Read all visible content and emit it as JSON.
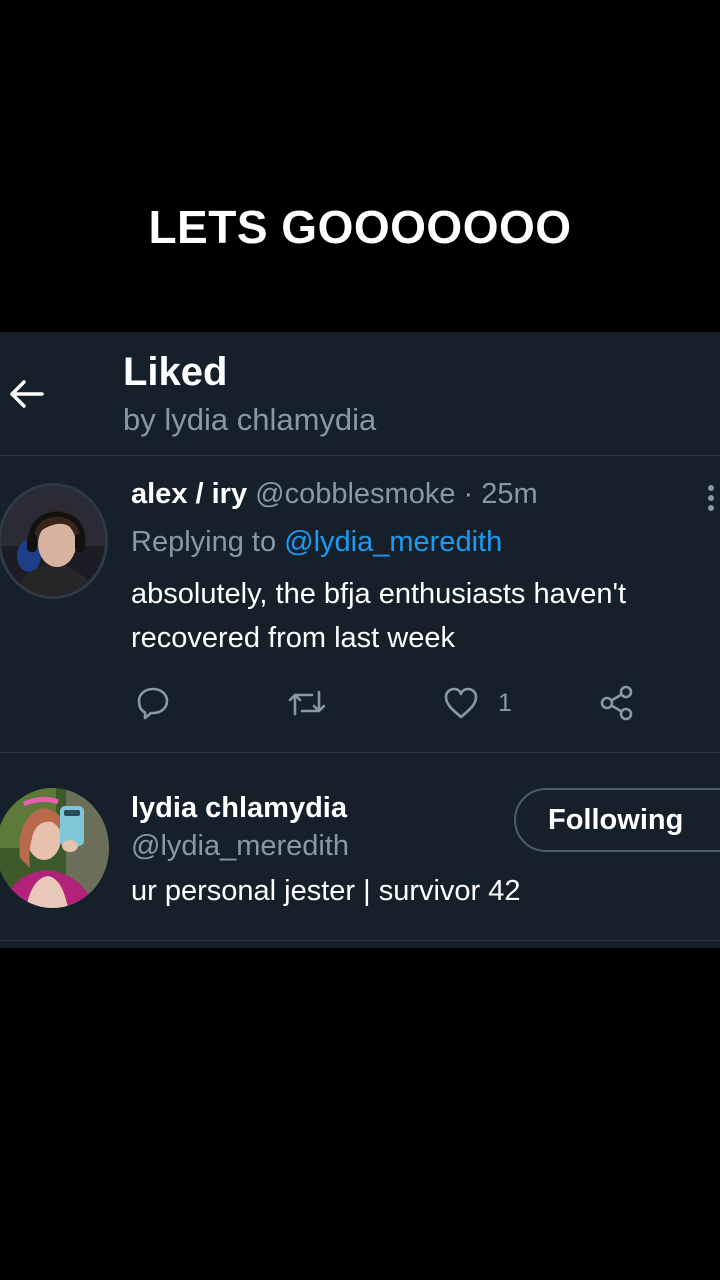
{
  "caption": "LETS GOOOOOOO",
  "header": {
    "title": "Liked",
    "subtitle": "by lydia chlamydia"
  },
  "tweet": {
    "display_name": "alex / iry",
    "handle": "@cobblesmoke",
    "separator": "·",
    "time": "25m",
    "replying_prefix": "Replying to",
    "replying_to": "@lydia_meredith",
    "text": "absolutely, the bfja enthusiasts haven't recovered from last week",
    "like_count": "1"
  },
  "user": {
    "display_name": "lydia chlamydia",
    "handle": "@lydia_meredith",
    "bio": "ur personal jester | survivor 42",
    "follow_label": "Following"
  },
  "colors": {
    "background": "#000000",
    "panel": "#15202b",
    "secondary_text": "#8899a6",
    "link": "#1d9bf0",
    "divider": "#2a3642"
  },
  "icons": [
    "arrow-left-icon",
    "more-vertical-icon",
    "reply-icon",
    "retweet-icon",
    "heart-icon",
    "share-icon"
  ]
}
